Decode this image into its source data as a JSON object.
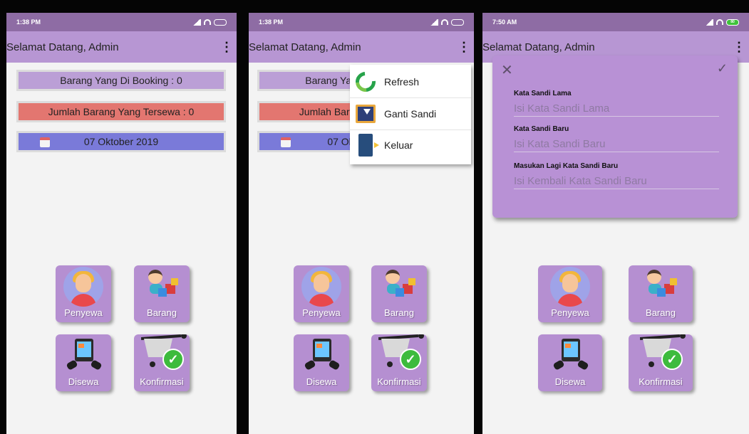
{
  "screens": [
    {
      "status": {
        "time": "1:38 PM"
      },
      "appbar": {
        "title": "Selamat Datang, Admin",
        "menu_icon": "⋮"
      },
      "cards": {
        "booking": "Barang Yang Di Booking : 0",
        "rented": "Jumlah Barang Yang Tersewa : 0",
        "date": "07 Oktober 2019"
      },
      "tiles": {
        "penyewa": "Penyewa",
        "barang": "Barang",
        "disewa": "Disewa",
        "konfirmasi": "Konfirmasi"
      }
    },
    {
      "status": {
        "time": "1:38 PM"
      },
      "appbar": {
        "title": "Selamat Datang, Admin",
        "menu_icon": "⋮"
      },
      "cards": {
        "booking": "Barang Yar",
        "rented": "Jumlah Baran",
        "date": "07 Ok"
      },
      "menu": {
        "refresh": "Refresh",
        "change_password": "Ganti Sandi",
        "logout": "Keluar"
      },
      "tiles": {
        "penyewa": "Penyewa",
        "barang": "Barang",
        "disewa": "Disewa",
        "konfirmasi": "Konfirmasi"
      }
    },
    {
      "status": {
        "time": "7:50 AM",
        "battery": "80"
      },
      "appbar": {
        "title": "Selamat Datang, Admin",
        "menu_icon": "⋮"
      },
      "dialog": {
        "close_icon": "✕",
        "ok_icon": "✓",
        "old_label": "Kata Sandi Lama",
        "old_placeholder": "Isi Kata Sandi Lama",
        "new_label": "Kata Sandi Baru",
        "new_placeholder": "Isi Kata Sandi Baru",
        "repeat_label": "Masukan Lagi Kata Sandi Baru",
        "repeat_placeholder": "Isi Kembali Kata Sandi Baru"
      },
      "tiles": {
        "penyewa": "Penyewa",
        "barang": "Barang",
        "disewa": "Disewa",
        "konfirmasi": "Konfirmasi"
      }
    }
  ],
  "colors": {
    "statusbar": "#8e6ca4",
    "appbar": "#b796d3",
    "card_purple": "#bb9fd6",
    "card_red": "#e37670",
    "card_blue": "#7a7ad9",
    "tile": "#b58fd1",
    "check_green": "#3dbb3d"
  },
  "icons": [
    "overflow-menu-icon",
    "calendar-icon",
    "user-female-icon",
    "baby-toys-icon",
    "tablet-hands-icon",
    "cart-check-icon",
    "refresh-icon",
    "download-icon",
    "exit-door-icon",
    "close-icon",
    "check-icon",
    "wifi-icon",
    "signal-icon",
    "battery-icon"
  ]
}
